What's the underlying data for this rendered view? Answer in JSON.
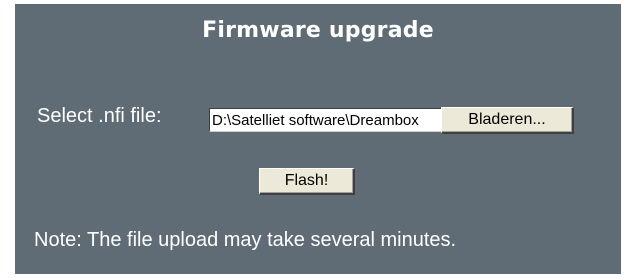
{
  "panel": {
    "title": "Firmware upgrade",
    "background_color": "#5f6b75"
  },
  "upload": {
    "label": "Select .nfi file:",
    "file_value": "D:\\Satelliet software\\Dreambox",
    "browse_label": "Bladeren..."
  },
  "actions": {
    "flash_label": "Flash!"
  },
  "note": "Note: The file upload may take several minutes."
}
